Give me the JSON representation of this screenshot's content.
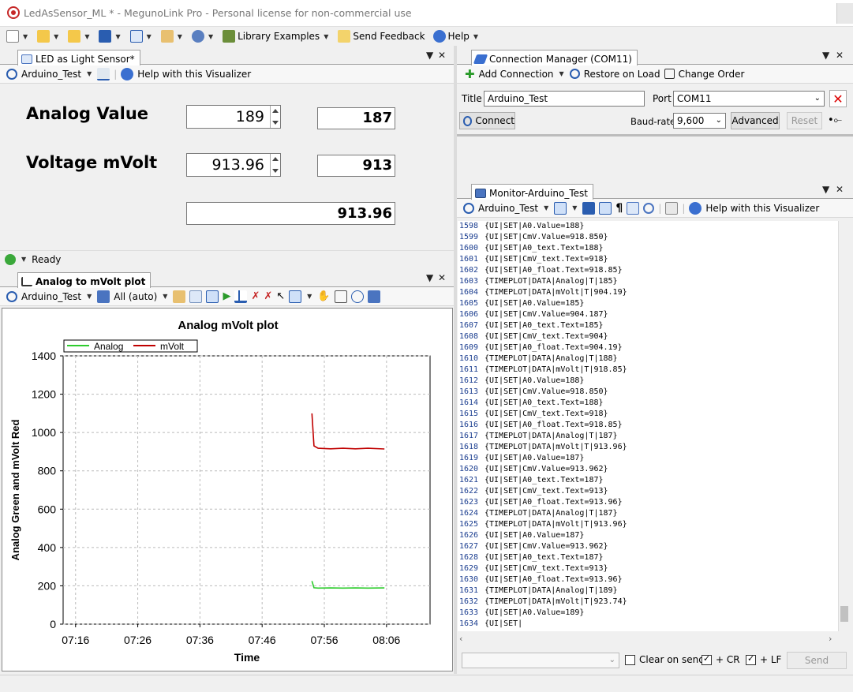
{
  "window": {
    "title": "LedAsSensor_ML * - MegunoLink Pro - Personal license for non-commercial use"
  },
  "toolbar": {
    "library_examples": "Library Examples",
    "send_feedback": "Send Feedback",
    "help": "Help"
  },
  "visualizer": {
    "tab": "LED as Light Sensor*",
    "device": "Arduino_Test",
    "help": "Help with this Visualizer",
    "analog_label": "Analog Value",
    "analog_spin": "189",
    "analog_text": "187",
    "voltage_label": "Voltage mVolt",
    "voltage_spin": "913.96",
    "voltage_text": "913",
    "float_text": "913.96",
    "status": "Ready"
  },
  "plot": {
    "tab": "Analog to mVolt plot",
    "device": "Arduino_Test",
    "series_select": "All (auto)"
  },
  "chart_data": {
    "type": "line",
    "title": "Analog mVolt plot",
    "xlabel": "Time",
    "ylabel": "Analog Green and mVolt Red",
    "ylim": [
      0,
      1400
    ],
    "yticks": [
      "0",
      "200",
      "400",
      "600",
      "800",
      "1000",
      "1200",
      "1400"
    ],
    "xticks": [
      "07:16",
      "07:26",
      "07:36",
      "07:46",
      "07:56",
      "08:06"
    ],
    "legend": "top-left",
    "grid": true,
    "series": [
      {
        "name": "Analog",
        "color": "#2ecc2e",
        "x": [
          "07:54:00",
          "07:54:20",
          "07:55:00",
          "07:57:00",
          "07:59:00",
          "08:01:00",
          "08:03:00",
          "08:05:40"
        ],
        "values": [
          225,
          190,
          188,
          189,
          188,
          189,
          188,
          189
        ]
      },
      {
        "name": "mVolt",
        "color": "#c00000",
        "x": [
          "07:54:00",
          "07:54:20",
          "07:55:00",
          "07:57:00",
          "07:59:00",
          "08:01:00",
          "08:03:00",
          "08:05:40"
        ],
        "values": [
          1100,
          930,
          918,
          915,
          918,
          915,
          918,
          914
        ]
      }
    ]
  },
  "connection": {
    "tab": "Connection Manager (COM11)",
    "add": "Add Connection",
    "restore": "Restore on Load",
    "order": "Change Order",
    "title_label": "Title",
    "title_value": "Arduino_Test",
    "port_label": "Port",
    "port_value": "COM11",
    "connect": "Connect",
    "baud_label": "Baud-rate",
    "baud_value": "9,600",
    "advanced": "Advanced",
    "reset": "Reset"
  },
  "monitor": {
    "tab": "Monitor-Arduino_Test",
    "device": "Arduino_Test",
    "help": "Help with this Visualizer",
    "lines": [
      [
        "1598",
        "{UI|SET|A0.Value=188}"
      ],
      [
        "1599",
        "{UI|SET|CmV.Value=918.850}"
      ],
      [
        "1600",
        "{UI|SET|A0_text.Text=188}"
      ],
      [
        "1601",
        "{UI|SET|CmV_text.Text=918}"
      ],
      [
        "1602",
        "{UI|SET|A0_float.Text=918.85}"
      ],
      [
        "1603",
        "{TIMEPLOT|DATA|Analog|T|185}"
      ],
      [
        "1604",
        "{TIMEPLOT|DATA|mVolt|T|904.19}"
      ],
      [
        "1605",
        "{UI|SET|A0.Value=185}"
      ],
      [
        "1606",
        "{UI|SET|CmV.Value=904.187}"
      ],
      [
        "1607",
        "{UI|SET|A0_text.Text=185}"
      ],
      [
        "1608",
        "{UI|SET|CmV_text.Text=904}"
      ],
      [
        "1609",
        "{UI|SET|A0_float.Text=904.19}"
      ],
      [
        "1610",
        "{TIMEPLOT|DATA|Analog|T|188}"
      ],
      [
        "1611",
        "{TIMEPLOT|DATA|mVolt|T|918.85}"
      ],
      [
        "1612",
        "{UI|SET|A0.Value=188}"
      ],
      [
        "1613",
        "{UI|SET|CmV.Value=918.850}"
      ],
      [
        "1614",
        "{UI|SET|A0_text.Text=188}"
      ],
      [
        "1615",
        "{UI|SET|CmV_text.Text=918}"
      ],
      [
        "1616",
        "{UI|SET|A0_float.Text=918.85}"
      ],
      [
        "1617",
        "{TIMEPLOT|DATA|Analog|T|187}"
      ],
      [
        "1618",
        "{TIMEPLOT|DATA|mVolt|T|913.96}"
      ],
      [
        "1619",
        "{UI|SET|A0.Value=187}"
      ],
      [
        "1620",
        "{UI|SET|CmV.Value=913.962}"
      ],
      [
        "1621",
        "{UI|SET|A0_text.Text=187}"
      ],
      [
        "1622",
        "{UI|SET|CmV_text.Text=913}"
      ],
      [
        "1623",
        "{UI|SET|A0_float.Text=913.96}"
      ],
      [
        "1624",
        "{TIMEPLOT|DATA|Analog|T|187}"
      ],
      [
        "1625",
        "{TIMEPLOT|DATA|mVolt|T|913.96}"
      ],
      [
        "1626",
        "{UI|SET|A0.Value=187}"
      ],
      [
        "1627",
        "{UI|SET|CmV.Value=913.962}"
      ],
      [
        "1628",
        "{UI|SET|A0_text.Text=187}"
      ],
      [
        "1629",
        "{UI|SET|CmV_text.Text=913}"
      ],
      [
        "1630",
        "{UI|SET|A0_float.Text=913.96}"
      ],
      [
        "1631",
        "{TIMEPLOT|DATA|Analog|T|189}"
      ],
      [
        "1632",
        "{TIMEPLOT|DATA|mVolt|T|923.74}"
      ],
      [
        "1633",
        "{UI|SET|A0.Value=189}"
      ],
      [
        "1634",
        "{UI|SET|"
      ]
    ],
    "clear_on_send": "Clear on send",
    "cr": "+ CR",
    "lf": "+ LF",
    "send": "Send"
  }
}
